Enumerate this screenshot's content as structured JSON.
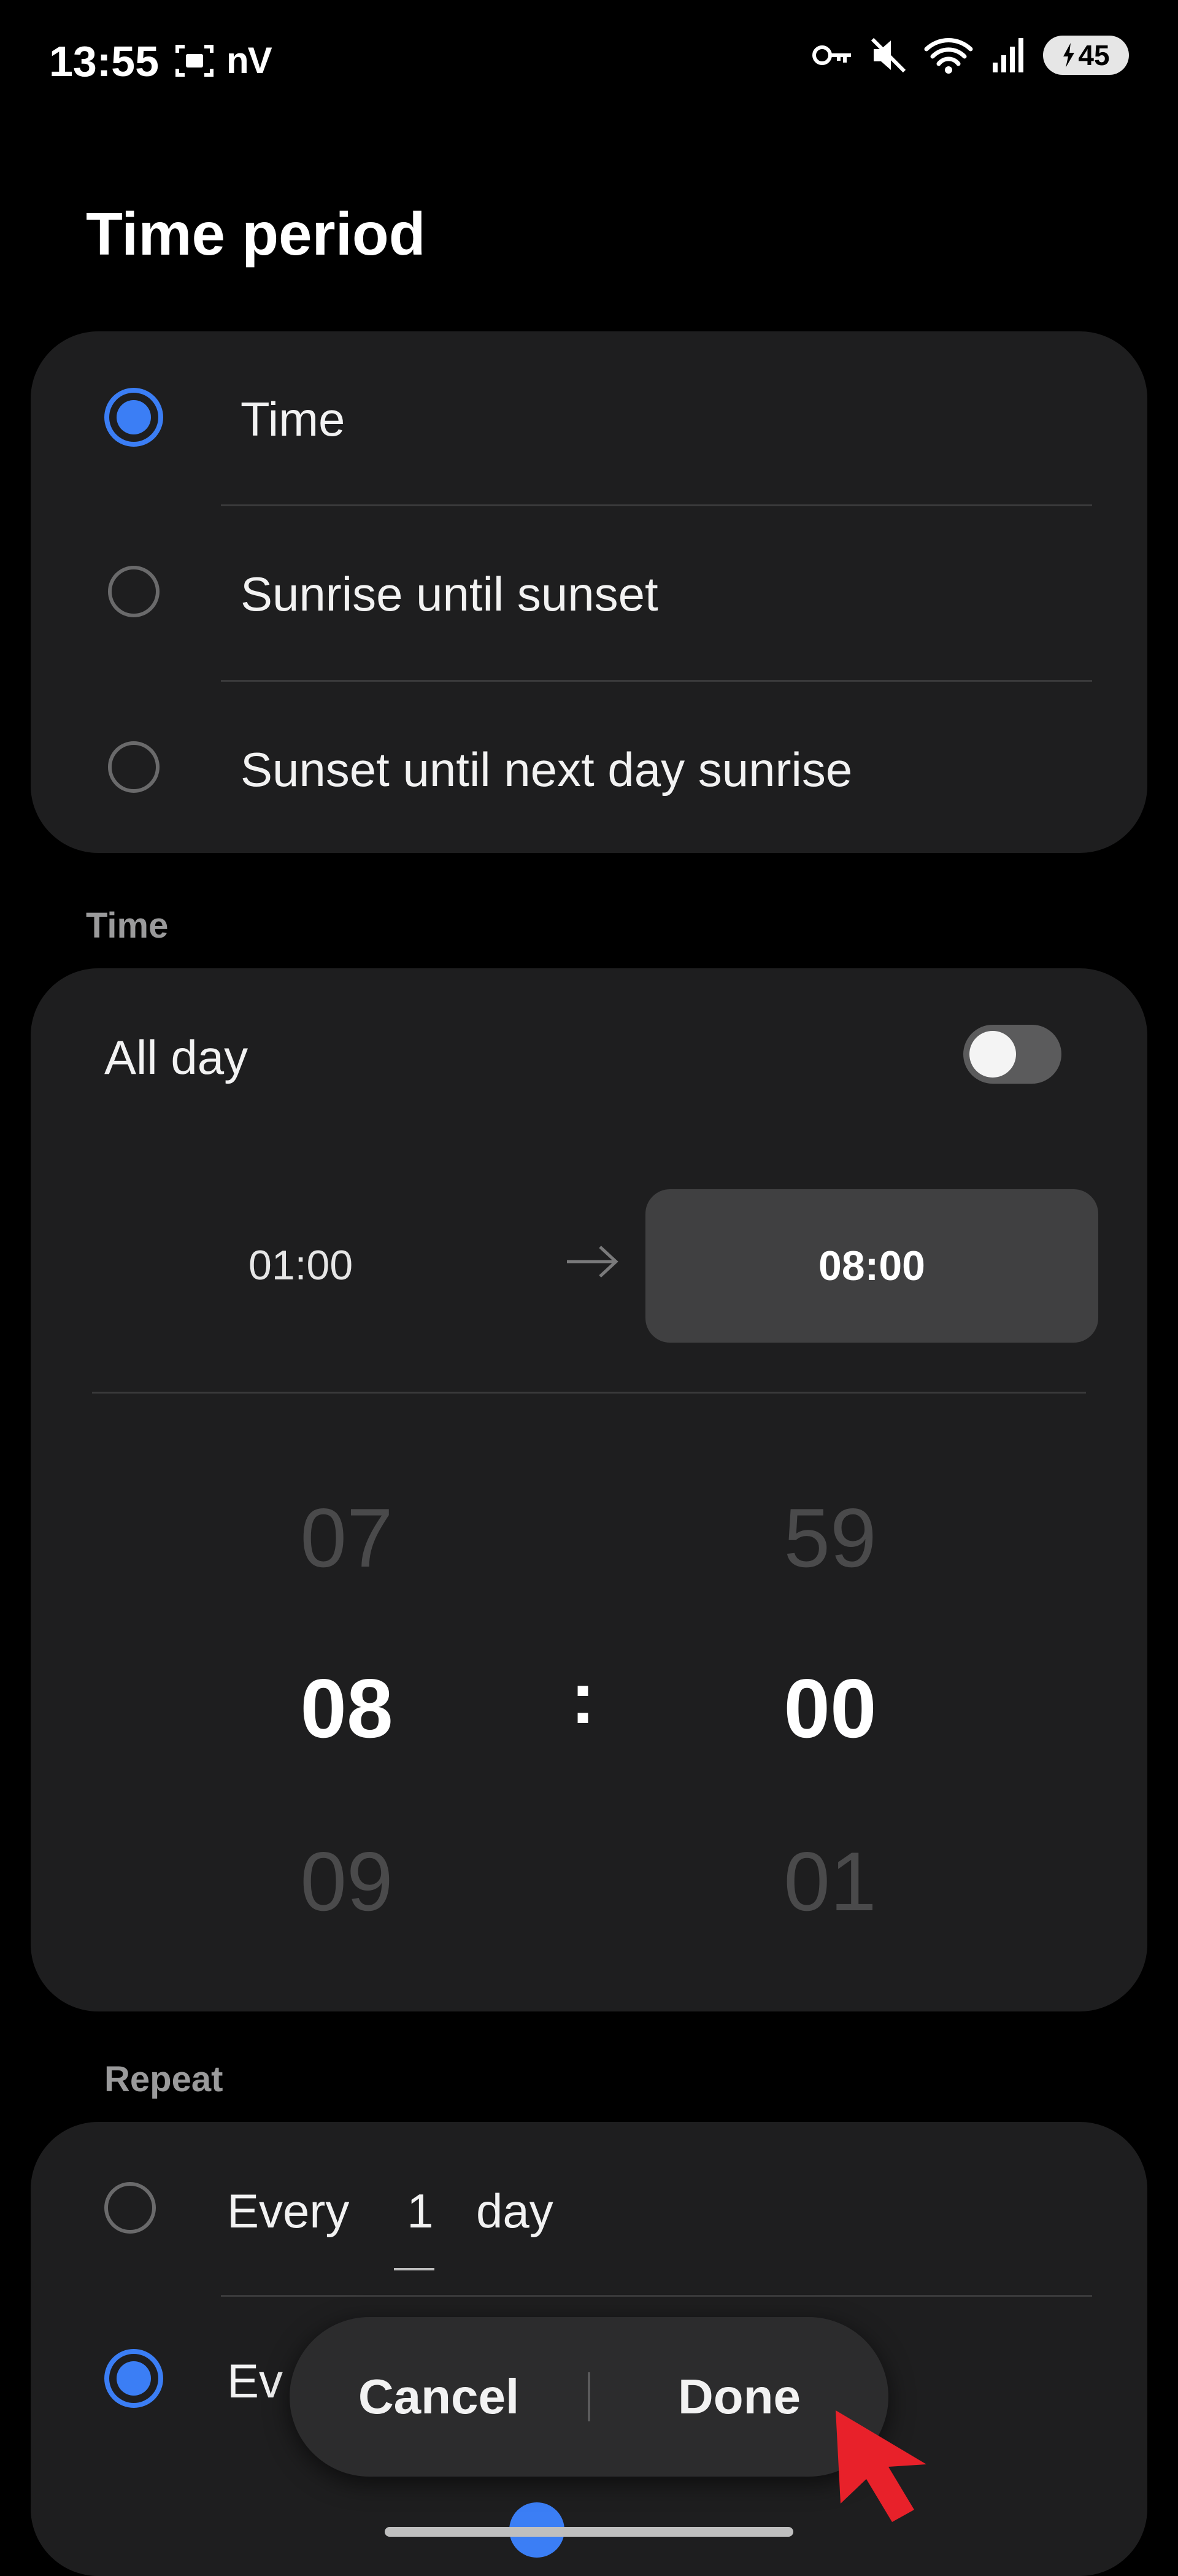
{
  "status_bar": {
    "time": "13:55",
    "left_icons": [
      "screenshot-icon",
      "n-icon",
      "v-icon"
    ],
    "left_text": "nV",
    "right_icons": [
      "key-icon",
      "mute-icon",
      "wifi-icon",
      "signal-icon"
    ],
    "battery": "45"
  },
  "page": {
    "title": "Time period"
  },
  "time_period": {
    "options": [
      {
        "label": "Time",
        "selected": true
      },
      {
        "label": "Sunrise until sunset",
        "selected": false
      },
      {
        "label": "Sunset until next day sunrise",
        "selected": false
      }
    ]
  },
  "time_section": {
    "header": "Time",
    "all_day_label": "All day",
    "all_day_on": false,
    "start_time": "01:00",
    "end_time": "08:00",
    "picker": {
      "hours_prev": "07",
      "hours_selected": "08",
      "hours_next": "09",
      "separator": ":",
      "minutes_prev": "59",
      "minutes_selected": "00",
      "minutes_next": "01"
    }
  },
  "repeat_section": {
    "header": "Repeat",
    "every_word": "Every",
    "every_value": "1",
    "every_unit": "day",
    "second_option_partial": "Ev"
  },
  "actions": {
    "cancel": "Cancel",
    "done": "Done"
  },
  "colors": {
    "accent": "#3b7ef5",
    "card": "#1e1e1f",
    "background": "#000000",
    "cursor": "#e8212a"
  }
}
